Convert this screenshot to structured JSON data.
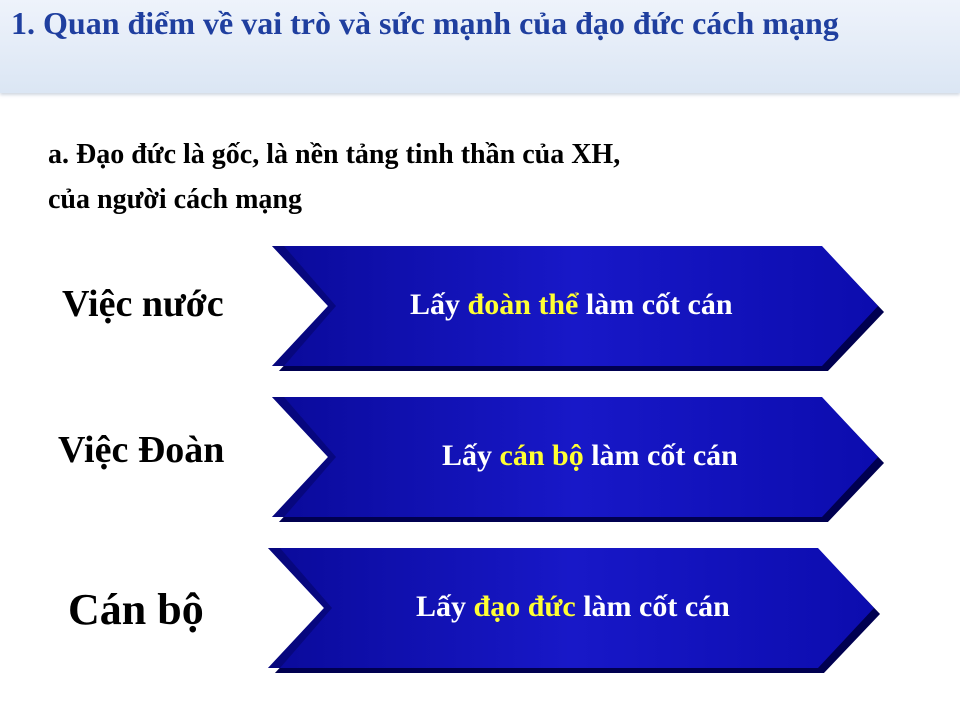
{
  "header": {
    "title": "1. Quan điểm về vai trò và sức mạnh của đạo đức cách mạng"
  },
  "subtitle": {
    "line1": "a. Đạo đức là gốc, là nền tảng tinh thần của XH,",
    "line2": "của người cách mạng"
  },
  "rows": [
    {
      "label": "Việc nước",
      "text_before": "Lấy ",
      "highlight": "đoàn thể",
      "text_after": " làm cốt cán"
    },
    {
      "label": "Việc Đoàn",
      "text_before": "Lấy ",
      "highlight": "cán bộ",
      "text_after": " làm cốt cán"
    },
    {
      "label": "Cán bộ",
      "text_before": "Lấy ",
      "highlight": "đạo đức",
      "text_after": " làm cốt cán"
    }
  ],
  "colors": {
    "title_text": "#1f3f9f",
    "arrow_fill": "#1010b8",
    "arrow_dark": "#000060",
    "highlight_text": "#ffff33"
  }
}
